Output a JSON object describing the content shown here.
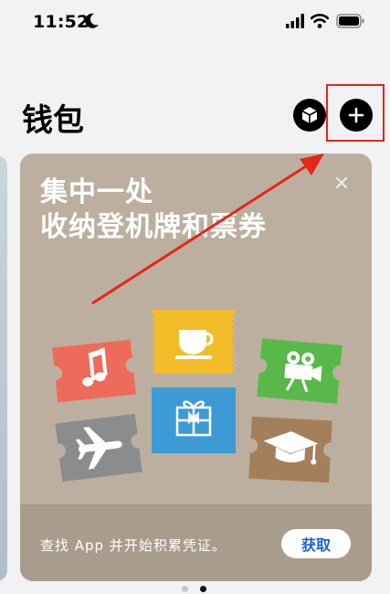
{
  "status_bar": {
    "time": "11:52",
    "icons": [
      "moon-icon",
      "signal-icon",
      "wifi-icon",
      "battery-icon"
    ]
  },
  "header": {
    "title": "钱包",
    "buttons": [
      "pass-icon",
      "plus-icon"
    ]
  },
  "promo": {
    "title_line1": "集中一处",
    "title_line2": "收纳登机牌和票券",
    "footer_text": "查找 App 并开始积累凭证。",
    "get_button": "获取",
    "tickets": [
      {
        "icon": "music-note-icon",
        "color": "#ee6a5b"
      },
      {
        "icon": "coffee-cup-icon",
        "color": "#f3bd2a"
      },
      {
        "icon": "movie-camera-icon",
        "color": "#58b84a"
      },
      {
        "icon": "airplane-icon",
        "color": "#8b8c8e"
      },
      {
        "icon": "gift-icon",
        "color": "#3c9bd6"
      },
      {
        "icon": "graduation-cap-icon",
        "color": "#a37f5c"
      }
    ]
  },
  "pagination": {
    "pages": 2,
    "current": 2
  },
  "colors": {
    "annotation": "#e5261a",
    "card_bg": "#bcaf9f",
    "link_blue": "#1f5fd6"
  }
}
